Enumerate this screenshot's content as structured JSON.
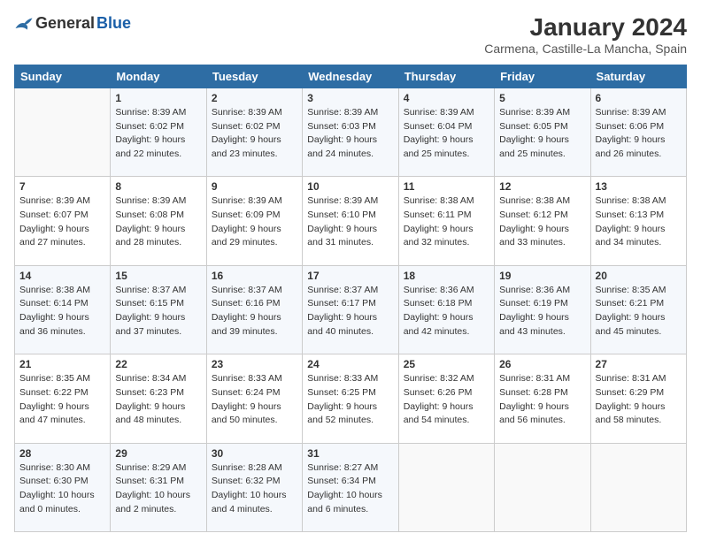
{
  "logo": {
    "general": "General",
    "blue": "Blue"
  },
  "title": "January 2024",
  "location": "Carmena, Castille-La Mancha, Spain",
  "days_of_week": [
    "Sunday",
    "Monday",
    "Tuesday",
    "Wednesday",
    "Thursday",
    "Friday",
    "Saturday"
  ],
  "weeks": [
    [
      {
        "day": "",
        "sunrise": "",
        "sunset": "",
        "daylight": ""
      },
      {
        "day": "1",
        "sunrise": "Sunrise: 8:39 AM",
        "sunset": "Sunset: 6:02 PM",
        "daylight": "Daylight: 9 hours and 22 minutes."
      },
      {
        "day": "2",
        "sunrise": "Sunrise: 8:39 AM",
        "sunset": "Sunset: 6:02 PM",
        "daylight": "Daylight: 9 hours and 23 minutes."
      },
      {
        "day": "3",
        "sunrise": "Sunrise: 8:39 AM",
        "sunset": "Sunset: 6:03 PM",
        "daylight": "Daylight: 9 hours and 24 minutes."
      },
      {
        "day": "4",
        "sunrise": "Sunrise: 8:39 AM",
        "sunset": "Sunset: 6:04 PM",
        "daylight": "Daylight: 9 hours and 25 minutes."
      },
      {
        "day": "5",
        "sunrise": "Sunrise: 8:39 AM",
        "sunset": "Sunset: 6:05 PM",
        "daylight": "Daylight: 9 hours and 25 minutes."
      },
      {
        "day": "6",
        "sunrise": "Sunrise: 8:39 AM",
        "sunset": "Sunset: 6:06 PM",
        "daylight": "Daylight: 9 hours and 26 minutes."
      }
    ],
    [
      {
        "day": "7",
        "sunrise": "Sunrise: 8:39 AM",
        "sunset": "Sunset: 6:07 PM",
        "daylight": "Daylight: 9 hours and 27 minutes."
      },
      {
        "day": "8",
        "sunrise": "Sunrise: 8:39 AM",
        "sunset": "Sunset: 6:08 PM",
        "daylight": "Daylight: 9 hours and 28 minutes."
      },
      {
        "day": "9",
        "sunrise": "Sunrise: 8:39 AM",
        "sunset": "Sunset: 6:09 PM",
        "daylight": "Daylight: 9 hours and 29 minutes."
      },
      {
        "day": "10",
        "sunrise": "Sunrise: 8:39 AM",
        "sunset": "Sunset: 6:10 PM",
        "daylight": "Daylight: 9 hours and 31 minutes."
      },
      {
        "day": "11",
        "sunrise": "Sunrise: 8:38 AM",
        "sunset": "Sunset: 6:11 PM",
        "daylight": "Daylight: 9 hours and 32 minutes."
      },
      {
        "day": "12",
        "sunrise": "Sunrise: 8:38 AM",
        "sunset": "Sunset: 6:12 PM",
        "daylight": "Daylight: 9 hours and 33 minutes."
      },
      {
        "day": "13",
        "sunrise": "Sunrise: 8:38 AM",
        "sunset": "Sunset: 6:13 PM",
        "daylight": "Daylight: 9 hours and 34 minutes."
      }
    ],
    [
      {
        "day": "14",
        "sunrise": "Sunrise: 8:38 AM",
        "sunset": "Sunset: 6:14 PM",
        "daylight": "Daylight: 9 hours and 36 minutes."
      },
      {
        "day": "15",
        "sunrise": "Sunrise: 8:37 AM",
        "sunset": "Sunset: 6:15 PM",
        "daylight": "Daylight: 9 hours and 37 minutes."
      },
      {
        "day": "16",
        "sunrise": "Sunrise: 8:37 AM",
        "sunset": "Sunset: 6:16 PM",
        "daylight": "Daylight: 9 hours and 39 minutes."
      },
      {
        "day": "17",
        "sunrise": "Sunrise: 8:37 AM",
        "sunset": "Sunset: 6:17 PM",
        "daylight": "Daylight: 9 hours and 40 minutes."
      },
      {
        "day": "18",
        "sunrise": "Sunrise: 8:36 AM",
        "sunset": "Sunset: 6:18 PM",
        "daylight": "Daylight: 9 hours and 42 minutes."
      },
      {
        "day": "19",
        "sunrise": "Sunrise: 8:36 AM",
        "sunset": "Sunset: 6:19 PM",
        "daylight": "Daylight: 9 hours and 43 minutes."
      },
      {
        "day": "20",
        "sunrise": "Sunrise: 8:35 AM",
        "sunset": "Sunset: 6:21 PM",
        "daylight": "Daylight: 9 hours and 45 minutes."
      }
    ],
    [
      {
        "day": "21",
        "sunrise": "Sunrise: 8:35 AM",
        "sunset": "Sunset: 6:22 PM",
        "daylight": "Daylight: 9 hours and 47 minutes."
      },
      {
        "day": "22",
        "sunrise": "Sunrise: 8:34 AM",
        "sunset": "Sunset: 6:23 PM",
        "daylight": "Daylight: 9 hours and 48 minutes."
      },
      {
        "day": "23",
        "sunrise": "Sunrise: 8:33 AM",
        "sunset": "Sunset: 6:24 PM",
        "daylight": "Daylight: 9 hours and 50 minutes."
      },
      {
        "day": "24",
        "sunrise": "Sunrise: 8:33 AM",
        "sunset": "Sunset: 6:25 PM",
        "daylight": "Daylight: 9 hours and 52 minutes."
      },
      {
        "day": "25",
        "sunrise": "Sunrise: 8:32 AM",
        "sunset": "Sunset: 6:26 PM",
        "daylight": "Daylight: 9 hours and 54 minutes."
      },
      {
        "day": "26",
        "sunrise": "Sunrise: 8:31 AM",
        "sunset": "Sunset: 6:28 PM",
        "daylight": "Daylight: 9 hours and 56 minutes."
      },
      {
        "day": "27",
        "sunrise": "Sunrise: 8:31 AM",
        "sunset": "Sunset: 6:29 PM",
        "daylight": "Daylight: 9 hours and 58 minutes."
      }
    ],
    [
      {
        "day": "28",
        "sunrise": "Sunrise: 8:30 AM",
        "sunset": "Sunset: 6:30 PM",
        "daylight": "Daylight: 10 hours and 0 minutes."
      },
      {
        "day": "29",
        "sunrise": "Sunrise: 8:29 AM",
        "sunset": "Sunset: 6:31 PM",
        "daylight": "Daylight: 10 hours and 2 minutes."
      },
      {
        "day": "30",
        "sunrise": "Sunrise: 8:28 AM",
        "sunset": "Sunset: 6:32 PM",
        "daylight": "Daylight: 10 hours and 4 minutes."
      },
      {
        "day": "31",
        "sunrise": "Sunrise: 8:27 AM",
        "sunset": "Sunset: 6:34 PM",
        "daylight": "Daylight: 10 hours and 6 minutes."
      },
      {
        "day": "",
        "sunrise": "",
        "sunset": "",
        "daylight": ""
      },
      {
        "day": "",
        "sunrise": "",
        "sunset": "",
        "daylight": ""
      },
      {
        "day": "",
        "sunrise": "",
        "sunset": "",
        "daylight": ""
      }
    ]
  ]
}
